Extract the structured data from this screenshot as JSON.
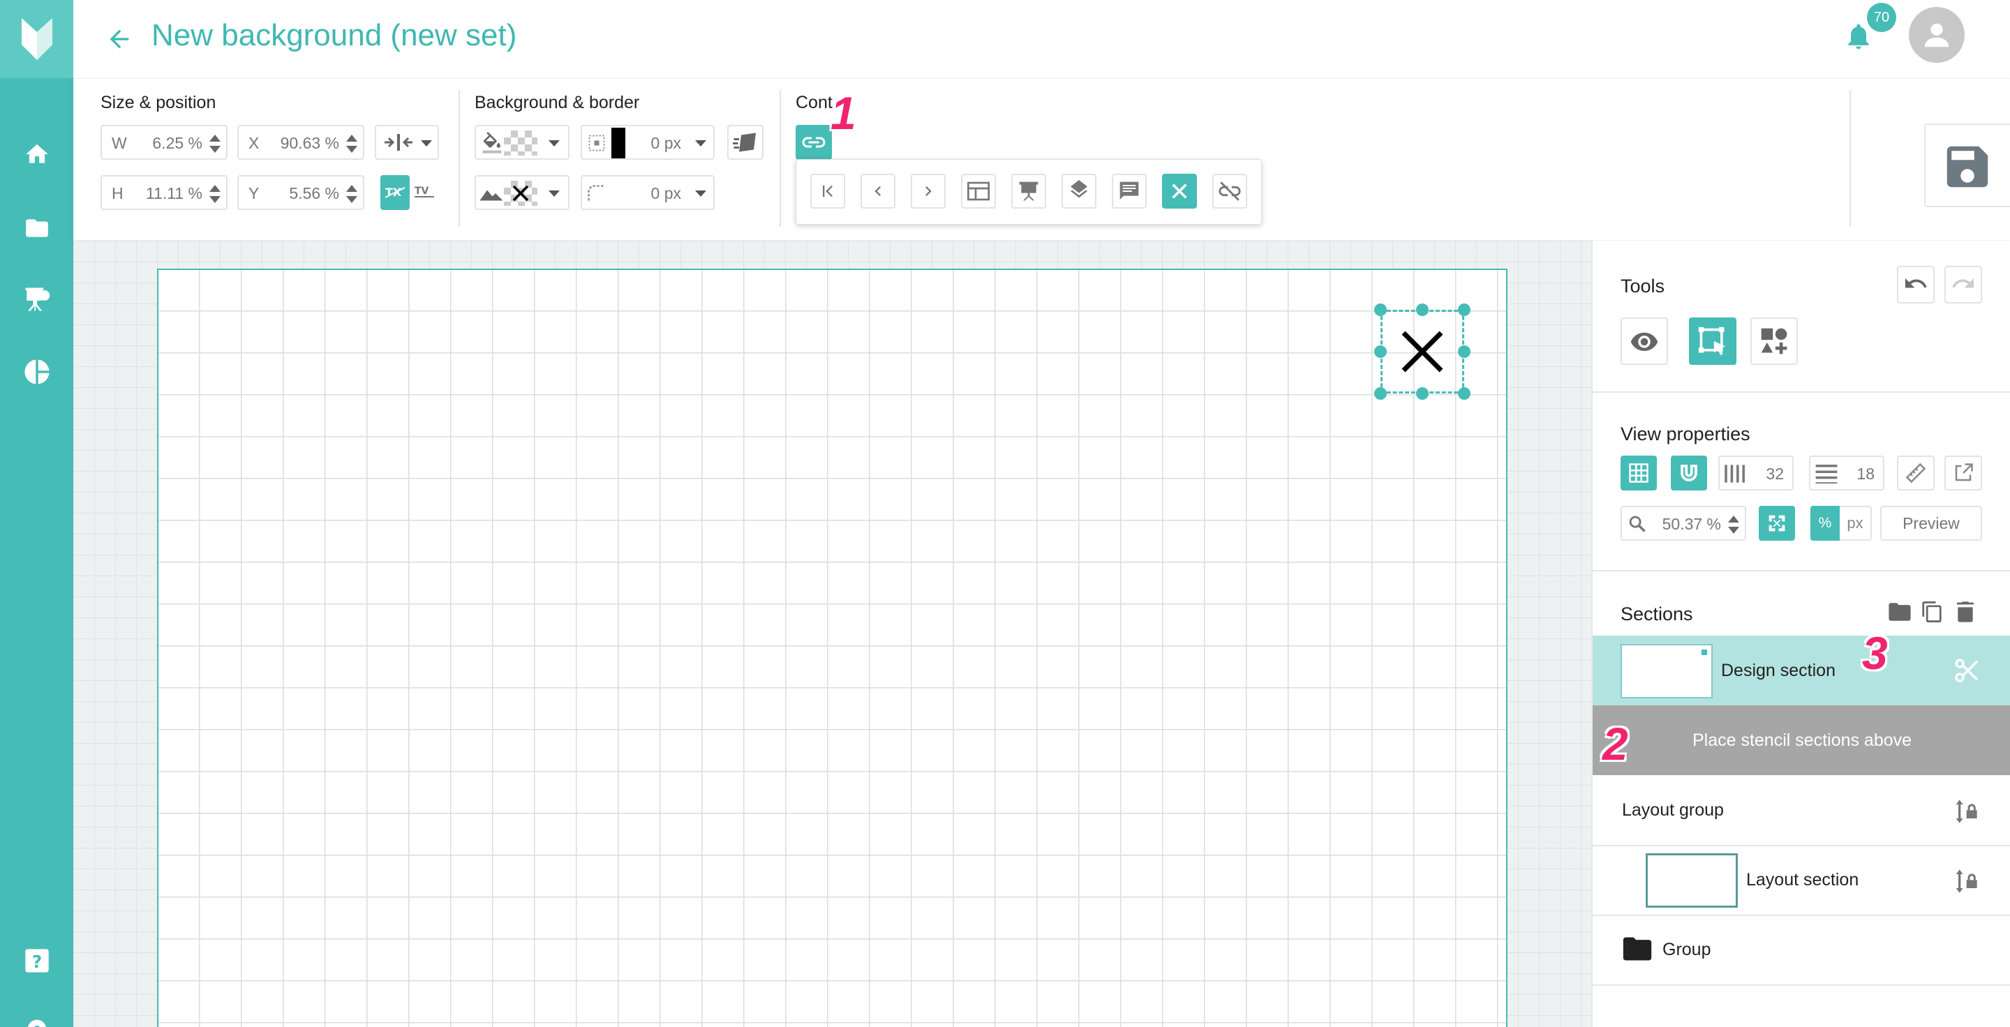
{
  "header": {
    "title": "New background (new set)",
    "notification_count": "70"
  },
  "toolbar": {
    "size_position": {
      "title": "Size & position",
      "w_label": "W",
      "w_value": "6.25 %",
      "x_label": "X",
      "x_value": "90.63 %",
      "h_label": "H",
      "h_value": "11.11 %",
      "y_label": "Y",
      "y_value": "5.56 %"
    },
    "background_border": {
      "title": "Background & border",
      "border_width": "0 px",
      "radius": "0 px"
    },
    "content": {
      "title": "Cont"
    }
  },
  "panel": {
    "tools_title": "Tools",
    "view_properties_title": "View properties",
    "columns": "32",
    "rows": "18",
    "zoom": "50.37 %",
    "unit_percent": "%",
    "unit_px": "px",
    "preview_label": "Preview",
    "sections_title": "Sections",
    "design_section": "Design section",
    "stencil_placeholder": "Place stencil sections above",
    "layout_group": "Layout group",
    "layout_section": "Layout section",
    "group": "Group"
  },
  "annotations": [
    "1",
    "2",
    "3"
  ],
  "colors": {
    "accent": "#46bcb6",
    "marker": "#f0246e",
    "stencil_bar": "#a6a6a6",
    "selected_section": "#b3e3e0"
  }
}
